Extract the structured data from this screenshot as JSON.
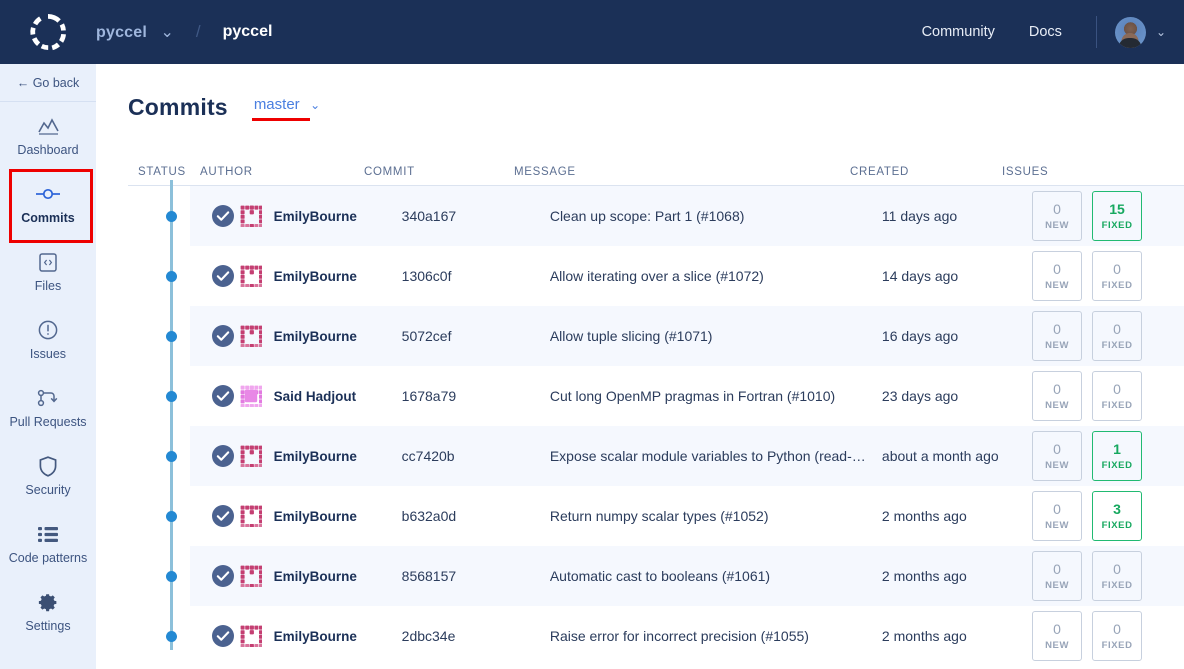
{
  "topbar": {
    "logo_icon": "codacy-dashed-circle-logo",
    "org": "pyccel",
    "separator": "/",
    "repo": "pyccel",
    "community_label": "Community",
    "docs_label": "Docs",
    "avatar_icon": "user-avatar",
    "caret_icon": "chevron-down-icon"
  },
  "sidebar": {
    "go_back_label": "← Go back",
    "items": [
      {
        "label": "Dashboard",
        "icon": "chart-icon",
        "active": false
      },
      {
        "label": "Commits",
        "icon": "commit-node-icon",
        "active": true
      },
      {
        "label": "Files",
        "icon": "code-file-icon",
        "active": false
      },
      {
        "label": "Issues",
        "icon": "alert-circle-icon",
        "active": false
      },
      {
        "label": "Pull Requests",
        "icon": "pull-request-icon",
        "active": false
      },
      {
        "label": "Security",
        "icon": "shield-icon",
        "active": false
      },
      {
        "label": "Code patterns",
        "icon": "list-icon",
        "active": false
      },
      {
        "label": "Settings",
        "icon": "gear-icon",
        "active": false
      }
    ]
  },
  "page": {
    "title": "Commits",
    "branch": "master",
    "branch_caret_icon": "chevron-down-icon",
    "highlight_color": "#ee0000"
  },
  "table": {
    "headers": {
      "status": "STATUS",
      "author": "AUTHOR",
      "commit": "COMMIT",
      "message": "MESSAGE",
      "created": "CREATED",
      "issues": "ISSUES"
    },
    "labels": {
      "new": "NEW",
      "fixed": "FIXED"
    },
    "rows": [
      {
        "status_icon": "check-circle-icon",
        "author": "EmilyBourne",
        "avatar_icon": "identicon-avatar",
        "commit": "340a167",
        "message": "Clean up scope: Part 1 (#1068)",
        "created": "11 days ago",
        "new": "0",
        "fixed": "15"
      },
      {
        "status_icon": "check-circle-icon",
        "author": "EmilyBourne",
        "avatar_icon": "identicon-avatar",
        "commit": "1306c0f",
        "message": "Allow iterating over a slice (#1072)",
        "created": "14 days ago",
        "new": "0",
        "fixed": "0"
      },
      {
        "status_icon": "check-circle-icon",
        "author": "EmilyBourne",
        "avatar_icon": "identicon-avatar",
        "commit": "5072cef",
        "message": "Allow tuple slicing (#1071)",
        "created": "16 days ago",
        "new": "0",
        "fixed": "0"
      },
      {
        "status_icon": "check-circle-icon",
        "author": "Said Hadjout",
        "avatar_icon": "identicon-avatar",
        "commit": "1678a79",
        "message": "Cut long OpenMP pragmas in Fortran (#1010)",
        "created": "23 days ago",
        "new": "0",
        "fixed": "0"
      },
      {
        "status_icon": "check-circle-icon",
        "author": "EmilyBourne",
        "avatar_icon": "identicon-avatar",
        "commit": "cc7420b",
        "message": "Expose scalar module variables to Python (read-…",
        "created": "about a month ago",
        "new": "0",
        "fixed": "1"
      },
      {
        "status_icon": "check-circle-icon",
        "author": "EmilyBourne",
        "avatar_icon": "identicon-avatar",
        "commit": "b632a0d",
        "message": "Return numpy scalar types (#1052)",
        "created": "2 months ago",
        "new": "0",
        "fixed": "3"
      },
      {
        "status_icon": "check-circle-icon",
        "author": "EmilyBourne",
        "avatar_icon": "identicon-avatar",
        "commit": "8568157",
        "message": "Automatic cast to booleans (#1061)",
        "created": "2 months ago",
        "new": "0",
        "fixed": "0"
      },
      {
        "status_icon": "check-circle-icon",
        "author": "EmilyBourne",
        "avatar_icon": "identicon-avatar",
        "commit": "2dbc34e",
        "message": "Raise error for incorrect precision (#1055)",
        "created": "2 months ago",
        "new": "0",
        "fixed": "0"
      }
    ]
  }
}
